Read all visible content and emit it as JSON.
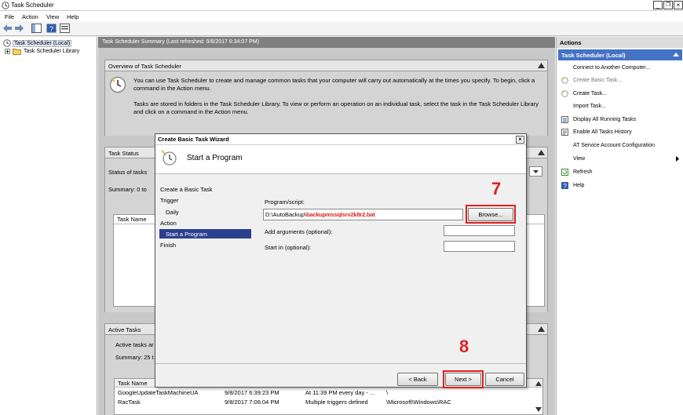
{
  "window": {
    "title": "Task Scheduler",
    "minimize": "_",
    "restore": "×",
    "close": "×"
  },
  "menu": {
    "file": "File",
    "action": "Action",
    "view": "View",
    "help": "Help"
  },
  "tree": {
    "root": "Task Scheduler (Local)",
    "library": "Task Scheduler Library"
  },
  "center": {
    "header": "Task Scheduler Summary (Last refreshed: 9/8/2017 6:34:07 PM)",
    "overview": {
      "title": "Overview of Task Scheduler",
      "p1": "You can use Task Scheduler to create and manage common tasks that your computer will carry out automatically at the times you specify. To begin, click a command in the Action menu.",
      "p2": "Tasks are stored in folders in the Task Scheduler Library. To view or perform an operation on an individual task, select the task in the Task Scheduler Library and click on a command in the Action menu."
    },
    "task_status": {
      "title": "Task Status",
      "status_label": "Status of tasks",
      "summary": "Summary: 0 to",
      "col_task_name": "Task Name"
    },
    "active_tasks": {
      "title": "Active Tasks",
      "desc": "Active tasks ar",
      "summary": "Summary: 25 t",
      "columns": [
        "Task Name",
        "",
        "",
        ""
      ],
      "rows": [
        [
          "GoogleUpdateTaskMachineUA",
          "9/8/2017 6:39:23 PM",
          "At 11:39 PM every day - ...",
          "\\"
        ],
        [
          "RacTask",
          "9/8/2017 7:06:04 PM",
          "Multiple triggers defined",
          "\\Microsoft\\Windows\\RAC"
        ]
      ]
    }
  },
  "actions": {
    "title": "Actions",
    "section": "Task Scheduler (Local)",
    "items": [
      {
        "label": "Connect to Another Computer...",
        "icon": "computer-icon"
      },
      {
        "label": "Create Basic Task...",
        "icon": "basic-task-icon"
      },
      {
        "label": "Create Task...",
        "icon": "create-task-icon"
      },
      {
        "label": "Import Task...",
        "icon": "blank-icon"
      },
      {
        "label": "Display All Running Tasks",
        "icon": "list-icon"
      },
      {
        "label": "Enable All Tasks History",
        "icon": "history-icon"
      },
      {
        "label": "AT Service Account Configuration",
        "icon": "blank-icon"
      },
      {
        "label": "View",
        "icon": "blank-icon"
      },
      {
        "label": "Refresh",
        "icon": "refresh-icon"
      },
      {
        "label": "Help",
        "icon": "help-icon"
      }
    ]
  },
  "wizard": {
    "title": "Create Basic Task Wizard",
    "close": "×",
    "header": "Start a Program",
    "steps": [
      "Create a Basic Task",
      "Trigger",
      "Daily",
      "Action",
      "Start a Program",
      "Finish"
    ],
    "program_label": "Program/script:",
    "program_prefix": "D:\\AutoBackup\\",
    "program_file": "backupmssqlsrv2k8r2.bat",
    "browse": "Browse...",
    "args_label": "Add arguments (optional):",
    "args_value": "",
    "startin_label": "Start in (optional):",
    "startin_value": "",
    "back": "< Back",
    "next": "Next >",
    "cancel": "Cancel"
  },
  "annotations": {
    "step7": "7",
    "step8": "8"
  },
  "colors": {
    "selection": "#4472c4",
    "annotation": "#e02020",
    "header_gray": "#7f7f7f"
  }
}
